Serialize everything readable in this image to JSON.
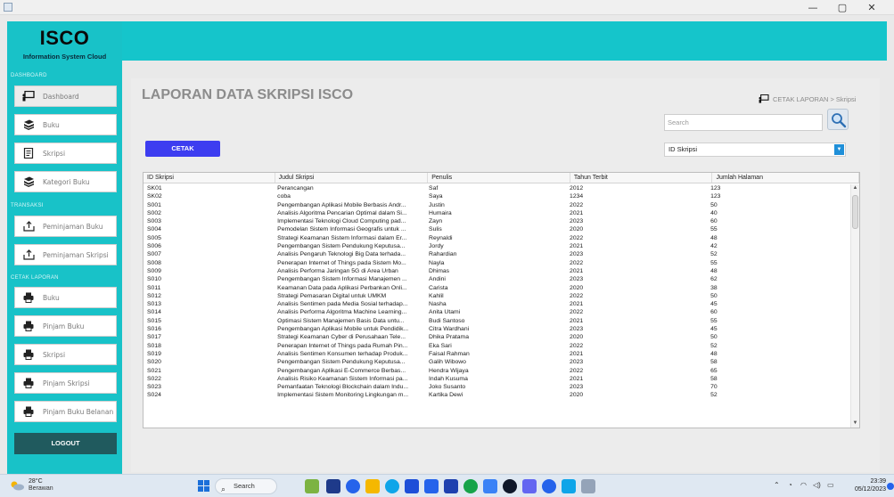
{
  "window": {
    "minimize": "—",
    "maximize": "▢",
    "close": "✕"
  },
  "sidebar": {
    "logo_title": "ISCO",
    "logo_subtitle": "Information System Cloud",
    "sections": {
      "dashboard": "DASHBOARD",
      "transaksi": "TRANSAKSI",
      "cetak": "CETAK LAPORAN"
    },
    "items": [
      {
        "label": "Dashboard",
        "icon": "presentation-icon"
      },
      {
        "label": "Buku",
        "icon": "books-icon"
      },
      {
        "label": "Skripsi",
        "icon": "document-icon"
      },
      {
        "label": "Kategori Buku",
        "icon": "books-icon"
      },
      {
        "label": "Peminjaman Buku",
        "icon": "upload-tray-icon"
      },
      {
        "label": "Peminjaman Skripsi",
        "icon": "upload-tray-icon"
      },
      {
        "label": "Buku",
        "icon": "printer-icon"
      },
      {
        "label": "Pinjam Buku",
        "icon": "printer-icon"
      },
      {
        "label": "Skripsi",
        "icon": "printer-icon"
      },
      {
        "label": "Pinjam Skripsi",
        "icon": "printer-icon"
      },
      {
        "label": "Pinjam Buku Belanan",
        "icon": "printer-icon"
      }
    ],
    "logout": "LOGOUT"
  },
  "main": {
    "title": "LAPORAN DATA SKRIPSI ISCO",
    "breadcrumb": "CETAK LAPORAN > Skripsi",
    "search_placeholder": "Search",
    "cetak_label": "CETAK",
    "filter_selected": "ID Skripsi"
  },
  "table": {
    "columns": [
      "ID Skripsi",
      "Judul Skripsi",
      "Penulis",
      "Tahun Terbit",
      "Jumlah Halaman"
    ],
    "rows": [
      [
        "SK01",
        "Perancangan",
        "Saf",
        "2012",
        "123"
      ],
      [
        "SK02",
        "coba",
        "Saya",
        "1234",
        "123"
      ],
      [
        "S001",
        "Pengembangan Aplikasi Mobile Berbasis Andr...",
        "Justin",
        "2022",
        "50"
      ],
      [
        "S002",
        "Analisis Algoritma Pencarian Optimal dalam Si...",
        "Humaira",
        "2021",
        "40"
      ],
      [
        "S003",
        "Implementasi Teknologi Cloud Computing pad...",
        "Zayn",
        "2023",
        "60"
      ],
      [
        "S004",
        "Pemodelan Sistem Informasi Geografis untuk ...",
        "Sulis",
        "2020",
        "55"
      ],
      [
        "S005",
        "Strategi Keamanan Sistem Informasi dalam Er...",
        "Reynaldi",
        "2022",
        "48"
      ],
      [
        "S006",
        "Pengembangan Sistem Pendukung Keputusa...",
        "Jordy",
        "2021",
        "42"
      ],
      [
        "S007",
        "Analisis Pengaruh Teknologi Big Data terhada...",
        "Rahardian",
        "2023",
        "52"
      ],
      [
        "S008",
        "Penerapan Internet of Things pada Sistem Mo...",
        "Nayla",
        "2022",
        "55"
      ],
      [
        "S009",
        "Analisis Performa Jaringan 5G di Area Urban",
        "Dhimas",
        "2021",
        "48"
      ],
      [
        "S010",
        "Pengembangan Sistem Informasi Manajemen ...",
        "Andini",
        "2023",
        "62"
      ],
      [
        "S011",
        "Keamanan Data pada Aplikasi Perbankan Onli...",
        "Carista",
        "2020",
        "38"
      ],
      [
        "S012",
        "Strategi Pemasaran Digital untuk UMKM",
        "Kahlil",
        "2022",
        "50"
      ],
      [
        "S013",
        "Analisis Sentimen pada Media Sosial terhadap...",
        "Nasha",
        "2021",
        "45"
      ],
      [
        "S014",
        "Analisis Performa Algoritma Machine Learning...",
        "Anita Utami",
        "2022",
        "60"
      ],
      [
        "S015",
        "Optimasi Sistem Manajemen Basis Data untu...",
        "Budi Santoso",
        "2021",
        "55"
      ],
      [
        "S016",
        "Pengembangan Aplikasi Mobile untuk Pendidik...",
        "Citra Wardhani",
        "2023",
        "45"
      ],
      [
        "S017",
        "Strategi Keamanan Cyber di Perusahaan Tele...",
        "Dhika Pratama",
        "2020",
        "50"
      ],
      [
        "S018",
        "Penerapan Internet of Things pada Rumah Pin...",
        "Eka Sari",
        "2022",
        "52"
      ],
      [
        "S019",
        "Analisis Sentimen Konsumen terhadap Produk...",
        "Faisal Rahman",
        "2021",
        "48"
      ],
      [
        "S020",
        "Pengembangan Sistem Pendukung Keputusa...",
        "Galih Wibowo",
        "2023",
        "58"
      ],
      [
        "S021",
        "Pengembangan Aplikasi E-Commerce Berbas...",
        "Hendra Wijaya",
        "2022",
        "65"
      ],
      [
        "S022",
        "Analisis Risiko Keamanan Sistem Informasi pa...",
        "Indah Kusuma",
        "2021",
        "58"
      ],
      [
        "S023",
        "Pemanfaatan Teknologi Blockchain dalam Indu...",
        "Joko Susanto",
        "2023",
        "70"
      ],
      [
        "S024",
        "Implementasi Sistem Monitoring Lingkungan m...",
        "Kartika Dewi",
        "2020",
        "52"
      ]
    ]
  },
  "taskbar": {
    "temperature": "28°C",
    "weather": "Berawan",
    "search_label": "Search",
    "time": "23:39",
    "date": "05/12/2023"
  },
  "colors": {
    "sidebar": "#18c2c8",
    "topband": "#15c5cb",
    "cetak_button": "#3d3df0",
    "logout_button": "#205a5e"
  }
}
